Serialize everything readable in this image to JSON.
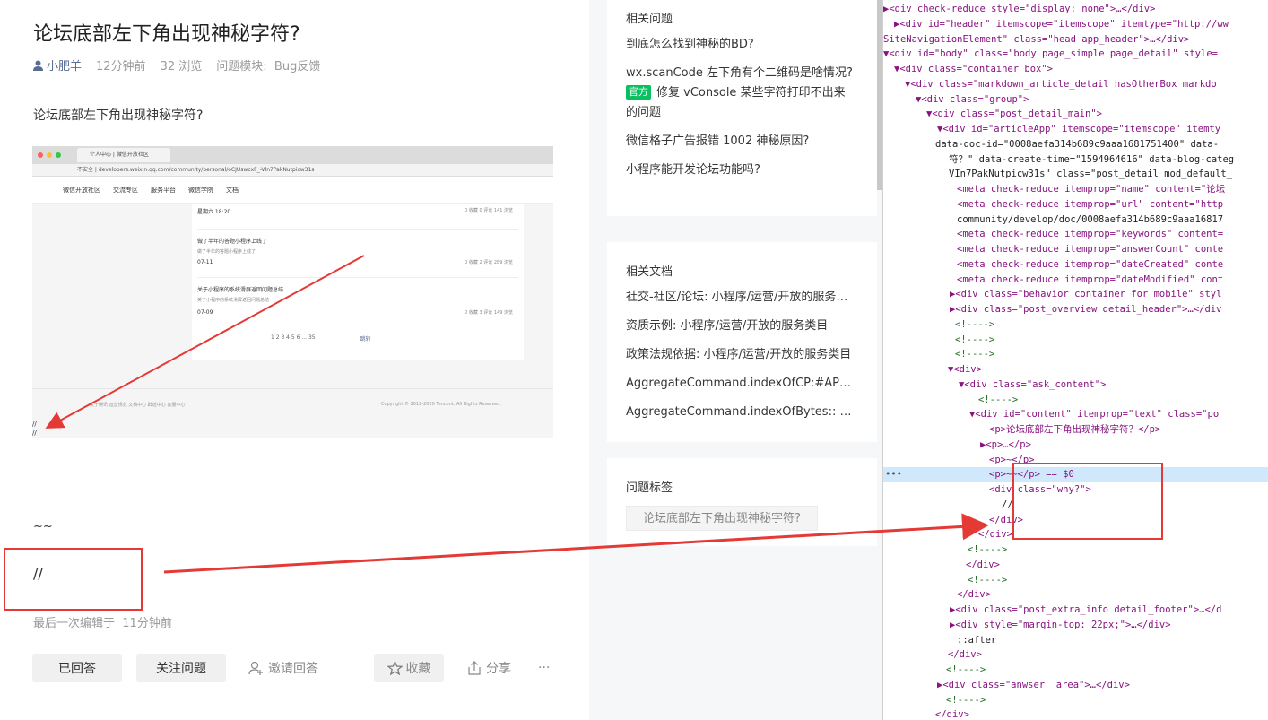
{
  "post": {
    "title": "论坛底部左下角出现神秘字符?",
    "author": "小肥羊",
    "time": "12分钟前",
    "views": "32 浏览",
    "module_label": "问题模块:",
    "module": "Bug反馈",
    "body_text": "论坛底部左下角出现神秘字符?",
    "tilde": "~~",
    "slashes": "//",
    "edited_label": "最后一次编辑于",
    "edited_time": "11分钟前"
  },
  "embedded_screenshot": {
    "tab_title": "个人中心 | 微信开放社区",
    "url": "不安全 | developers.weixin.qq.com/community/personal/oCJUswcxF_-Vln7PakNutpicw31s",
    "nav": [
      "微信开放社区",
      "交流专区",
      "服务平台",
      "微信学院",
      "文档"
    ],
    "rows": [
      {
        "title": "星期六 18:20",
        "sub": "",
        "stats": "0 收藏   0 评论   141 浏览"
      },
      {
        "title": "做了半年的答题小程序上线了",
        "sub": "做了半年的答题小程序上线了",
        "stats": ""
      },
      {
        "title": "07-11",
        "sub": "",
        "stats": "0 收藏   2 评论   289 浏览"
      },
      {
        "title": "关于小程序的系统滑屏返回问题总结",
        "sub": "关于小程序的系统滑屏返回问题总结",
        "stats": ""
      },
      {
        "title": "07-09",
        "sub": "",
        "stats": "0 收藏   3 评论   149 浏览"
      }
    ],
    "pager": "1   2   3   4   5   6  ...  35",
    "jump": "跳转",
    "footer_links": "关于腾讯    运营规范    文档中心    辟谣中心    客服中心",
    "copyright": "Copyright © 2012-2020 Tencent. All Rights Reserved.",
    "slashes": "//"
  },
  "actions": {
    "answered": "已回答",
    "follow": "关注问题",
    "invite": "邀请回答",
    "collect": "收藏",
    "share": "分享",
    "more": "···"
  },
  "sidebar": {
    "related_questions_title": "相关问题",
    "related_questions": [
      "到底怎么找到神秘的BD?",
      "wx.scanCode 左下角有个二维码是啥情况?",
      "修复 vConsole 某些字符打印不出来的问题",
      "微信格子广告报错 1002 神秘原因?",
      "小程序能开发论坛功能吗?"
    ],
    "official_badge": "官方",
    "related_docs_title": "相关文档",
    "related_docs": [
      "社交-社区/论坛: 小程序/运营/开放的服务类目",
      "资质示例: 小程序/运营/开放的服务类目",
      "政策法规依据: 小程序/运营/开放的服务类目",
      "AggregateCommand.indexOfCP:#API参考",
      "AggregateCommand.indexOfBytes:: #API参考"
    ],
    "tags_title": "问题标签",
    "tags": [
      "论坛底部左下角出现神秘字符?"
    ]
  },
  "devtools_lines": [
    "▶<div check-reduce style=\"display: none\">…</div>",
    "▶<div id=\"header\" itemscope=\"itemscope\" itemtype=\"http://ww",
    "SiteNavigationElement\" class=\"head app_header\">…</div>",
    "▼<div id=\"body\" class=\"body page_simple page_detail\" style=",
    "▼<div class=\"container_box\">",
    "▼<div class=\"markdown_article_detail hasOtherBox markdo",
    "▼<div class=\"group\">",
    "▼<div class=\"post_detail_main\">",
    "▼<div id=\"articleApp\" itemscope=\"itemscope\" itemty",
    "data-doc-id=\"0008aefa314b689c9aaa1681751400\" data-",
    "符？\" data-create-time=\"1594964616\" data-blog-categ",
    "VIn7PakNutpicw31s\" class=\"post_detail mod_default_",
    "<meta check-reduce itemprop=\"name\" content=\"论坛",
    "<meta check-reduce itemprop=\"url\" content=\"http",
    "community/develop/doc/0008aefa314b689c9aaa16817",
    "<meta check-reduce itemprop=\"keywords\" content=",
    "<meta check-reduce itemprop=\"answerCount\" conte",
    "<meta check-reduce itemprop=\"dateCreated\" conte",
    "<meta check-reduce itemprop=\"dateModified\" cont",
    "▶<div class=\"behavior_container for_mobile\" styl",
    "▶<div class=\"post_overview detail_header\">…</div",
    "<!---->",
    "<!---->",
    "<!---->",
    "▼<div>",
    "▼<div class=\"ask_content\">",
    "<!---->",
    "▼<div id=\"content\" itemprop=\"text\" class=\"po",
    "<p>论坛底部左下角出现神秘字符？</p>",
    "▶<p>…</p>",
    "<p>~</p>",
    "<p>~~</p> == $0",
    "<div class=\"why?\">",
    "//",
    "</div>",
    "</div>",
    "<!---->",
    "</div>",
    "<!---->",
    "</div>",
    "▶<div class=\"post_extra_info detail_footer\">…</d",
    "▶<div style=\"margin-top: 22px;\">…</div>",
    "::after",
    "</div>",
    "<!---->",
    "▶<div class=\"anwser__area\">…</div>",
    "<!---->",
    "</div>"
  ],
  "colors": {
    "accent_green": "#07c160",
    "annotation_red": "#e53935",
    "link_blue": "#576b95"
  }
}
